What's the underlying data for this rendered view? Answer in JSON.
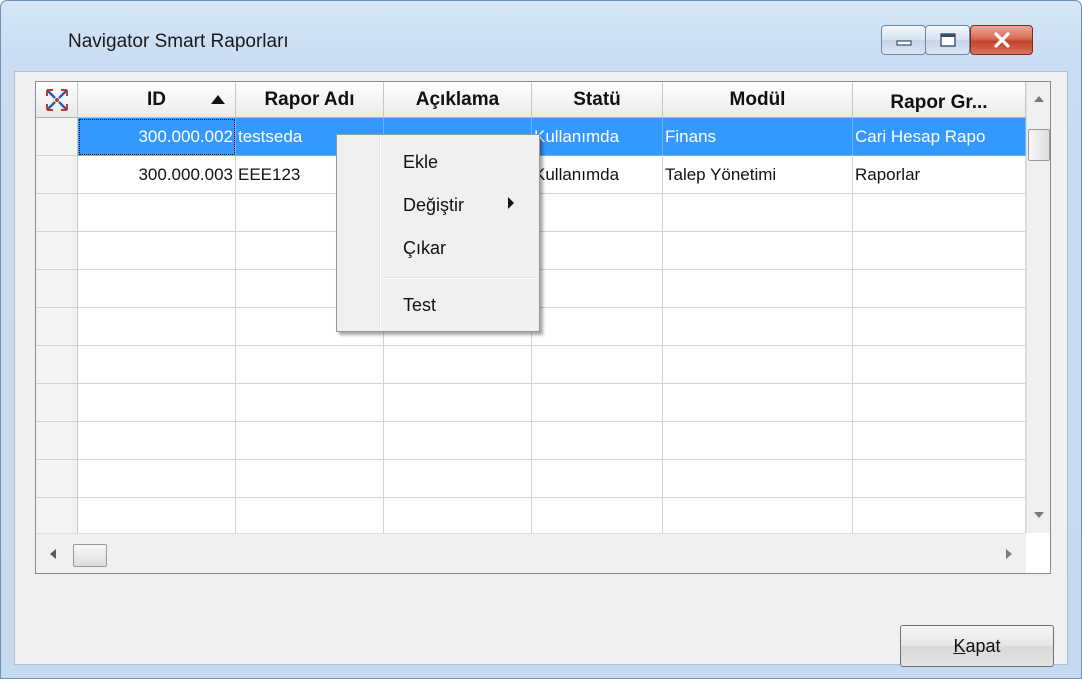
{
  "window": {
    "title": "Navigator Smart Raporları",
    "accent": "#3399ff",
    "close_color": "#c4432c"
  },
  "grid": {
    "corner_icon": "select-all-arrows-icon",
    "columns": [
      "ID",
      "Rapor Adı",
      "Açıklama",
      "Statü",
      "Modül",
      "Rapor Gr..."
    ],
    "sort_column": "ID",
    "sort_direction": "ascending",
    "rows": [
      {
        "id": "300.000.002",
        "rapor_adi": "testseda",
        "aciklama": "",
        "statu": "Kullanımda",
        "modul": "Finans",
        "rapor_grubu": "Cari Hesap Rapo",
        "selected": true
      },
      {
        "id": "300.000.003",
        "rapor_adi": "EEE123",
        "aciklama": "",
        "statu": "Kullanımda",
        "modul": "Talep Yönetimi",
        "rapor_grubu": "Raporlar",
        "selected": false
      }
    ]
  },
  "context_menu": {
    "items": [
      "Ekle",
      "Değiştir",
      "Çıkar",
      "Test"
    ],
    "submenu_item": "Değiştir"
  },
  "footer": {
    "close_label_accel": "K",
    "close_label_rest": "apat"
  }
}
